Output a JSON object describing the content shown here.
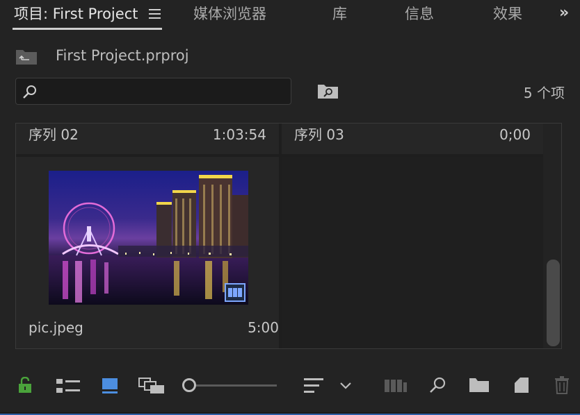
{
  "tabs": [
    {
      "label": "项目: First Project",
      "active": true
    },
    {
      "label": "媒体浏览器",
      "active": false
    },
    {
      "label": "库",
      "active": false
    },
    {
      "label": "信息",
      "active": false
    },
    {
      "label": "效果",
      "active": false
    }
  ],
  "overflow_label": "»",
  "project": {
    "file_name": "First Project.prproj"
  },
  "search": {
    "value": "",
    "placeholder": ""
  },
  "item_count": "5 个项",
  "tiles": [
    {
      "title": "序列 02",
      "duration": "1:03:54"
    },
    {
      "title": "序列 03",
      "duration": "0;00"
    },
    {
      "title": "pic.jpeg",
      "duration": "5:00"
    }
  ],
  "colors": {
    "background": "#232323",
    "accent_blue": "#4c8ee0",
    "lock_green": "#4aa33b"
  },
  "icons": [
    "menu-icon",
    "project-file-icon",
    "search-icon",
    "bin-search-icon",
    "lock-icon",
    "list-view-icon",
    "icon-view-icon",
    "freeform-view-icon",
    "zoom-slider",
    "sort-icon",
    "chevron-down-icon",
    "automate-sequence-icon",
    "find-icon",
    "new-bin-icon",
    "new-item-icon",
    "trash-icon"
  ]
}
